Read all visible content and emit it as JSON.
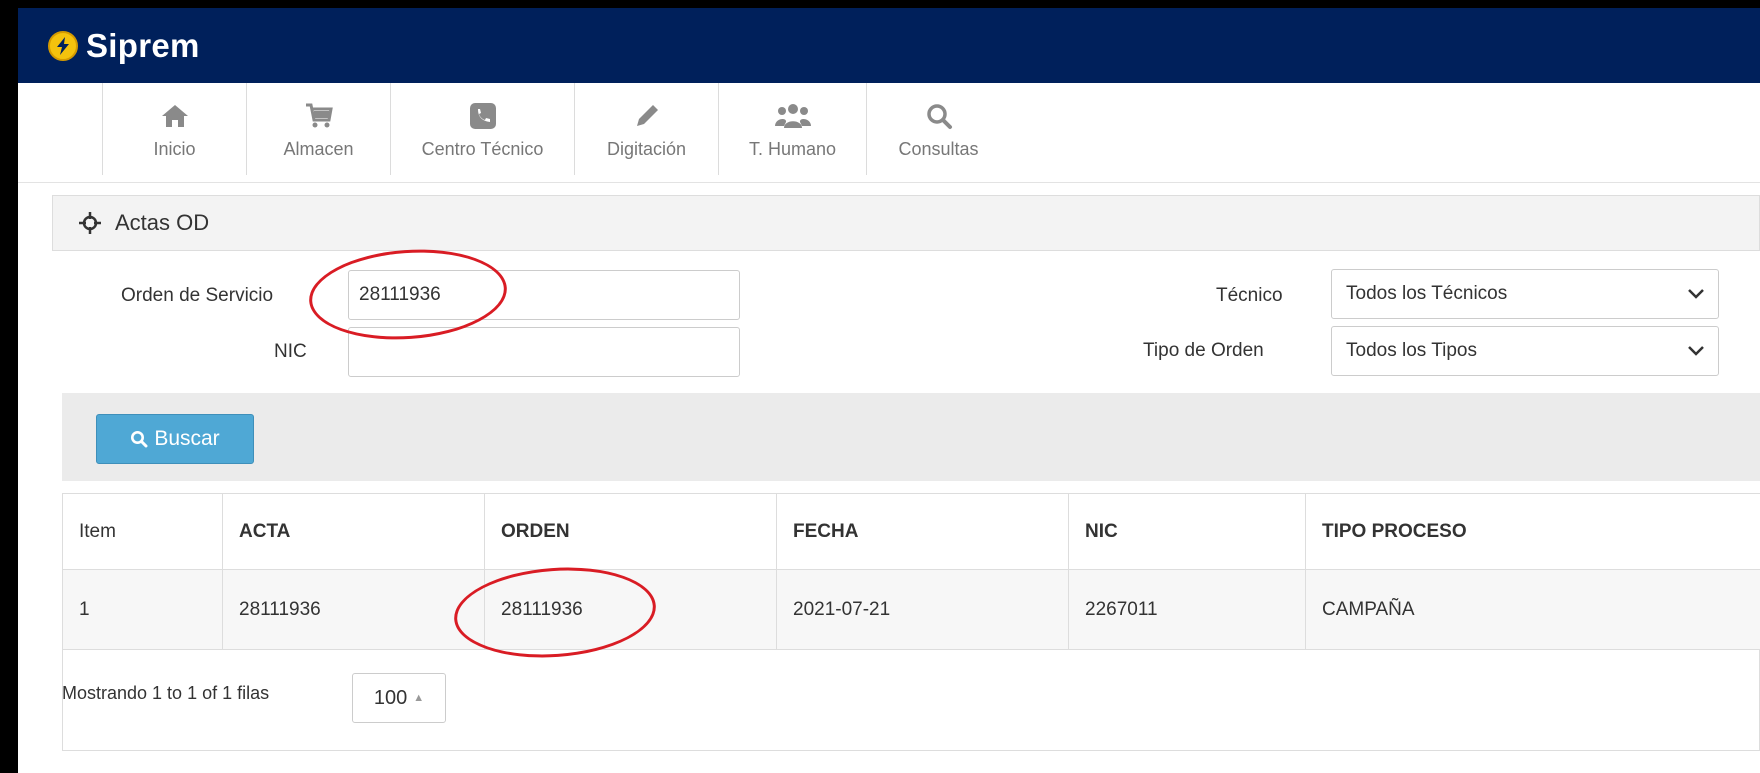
{
  "app": {
    "name": "Siprem"
  },
  "nav": {
    "items": [
      {
        "label": "Inicio",
        "icon": "home-icon"
      },
      {
        "label": "Almacen",
        "icon": "cart-icon"
      },
      {
        "label": "Centro Técnico",
        "icon": "phone-icon"
      },
      {
        "label": "Digitación",
        "icon": "pencil-icon"
      },
      {
        "label": "T. Humano",
        "icon": "users-icon"
      },
      {
        "label": "Consultas",
        "icon": "search-icon"
      }
    ]
  },
  "panel": {
    "title": "Actas OD",
    "icon": "crosshair-icon"
  },
  "form": {
    "orden_label": "Orden de Servicio",
    "orden_value": "28111936",
    "nic_label": "NIC",
    "nic_value": "",
    "tecnico_label": "Técnico",
    "tecnico_value": "Todos los Técnicos",
    "tipo_label": "Tipo de Orden",
    "tipo_value": "Todos los Tipos",
    "search_button": "Buscar"
  },
  "table": {
    "columns": [
      "Item",
      "ACTA",
      "ORDEN",
      "FECHA",
      "NIC",
      "TIPO PROCESO"
    ],
    "rows": [
      [
        "1",
        "28111936",
        "28111936",
        "2021-07-21",
        "2267011",
        "CAMPAÑA"
      ]
    ]
  },
  "pagination": {
    "info": "Mostrando 1 to 1 of 1 filas",
    "page_size": "100"
  },
  "colors": {
    "topbar": "#00205b",
    "button": "#4fa8d5",
    "annotation": "#d91c24"
  }
}
